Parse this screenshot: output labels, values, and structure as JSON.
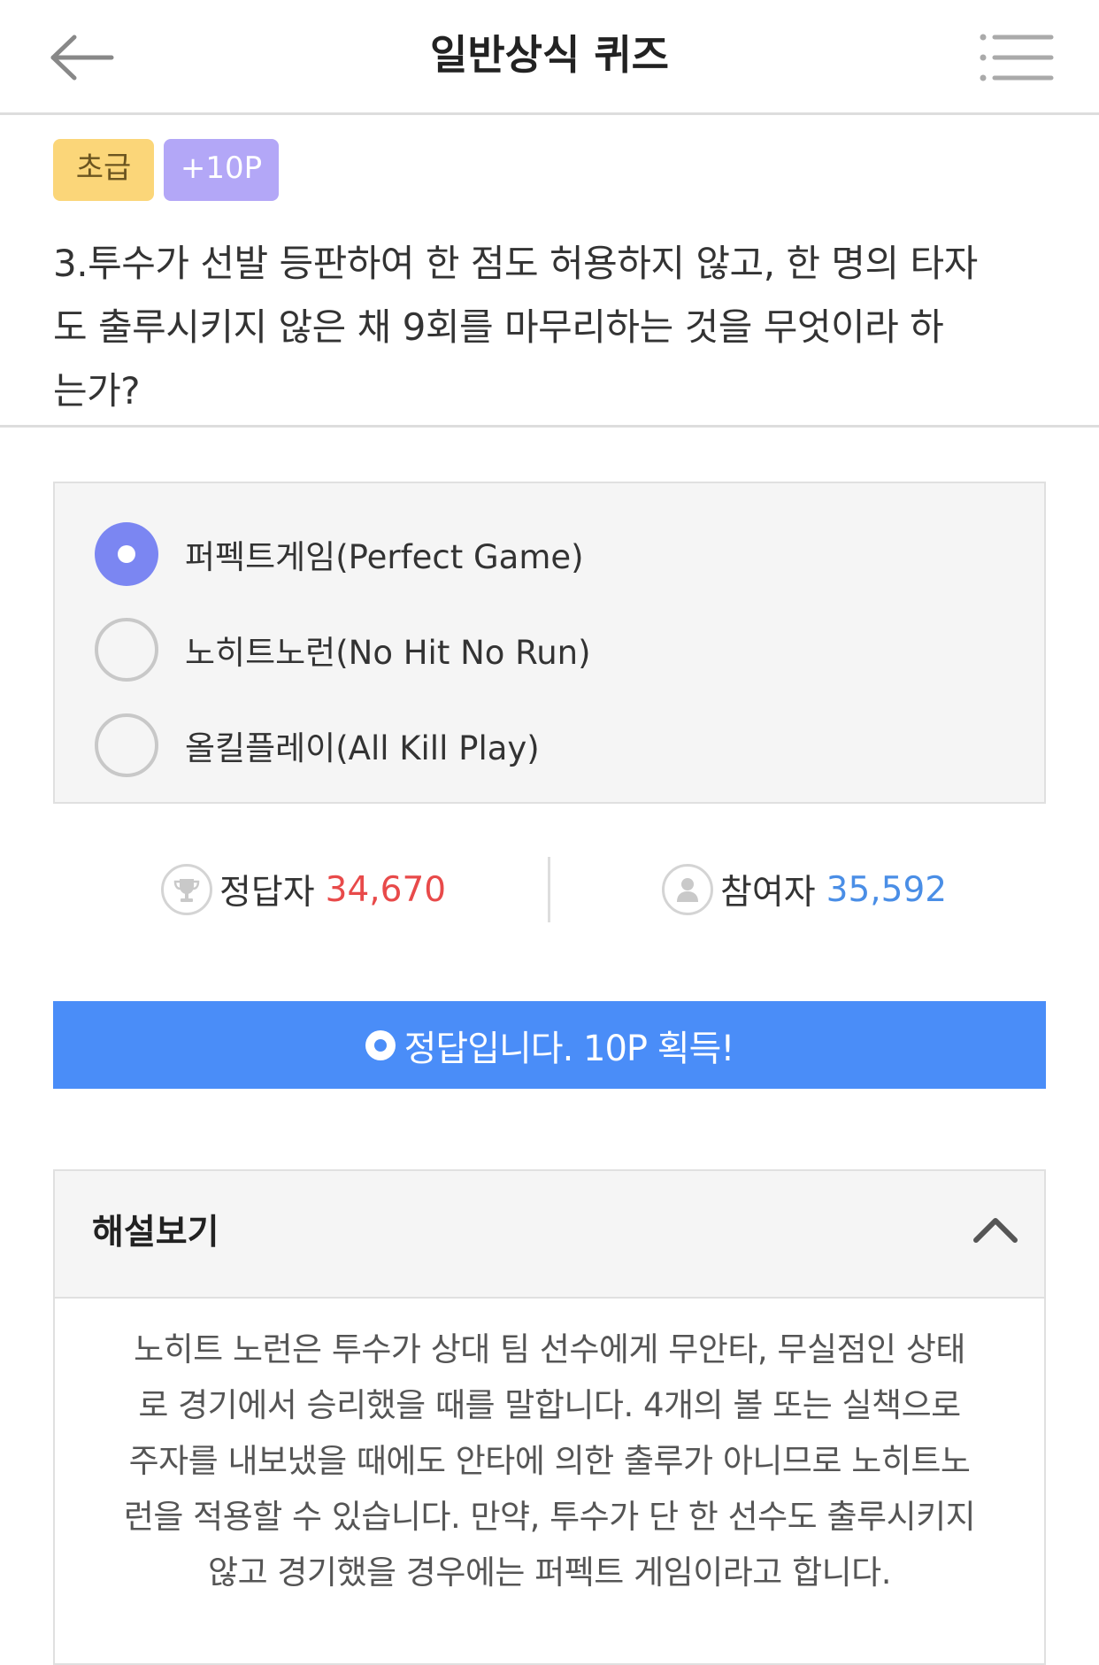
{
  "header": {
    "title": "일반상식 퀴즈",
    "back_icon": "arrow-left-icon",
    "menu_icon": "list-menu-icon"
  },
  "badges": {
    "level": "초급",
    "points": "+10P"
  },
  "question": {
    "lines": [
      "3.투수가 선발 등판하여 한 점도 허용하지 않고, 한 명의 타자",
      "도 출루시키지 않은 채 9회를 마무리하는 것을 무엇이라 하",
      "는가?"
    ]
  },
  "options": [
    {
      "label": "퍼펙트게임(Perfect Game)",
      "selected": true
    },
    {
      "label": "노히트노런(No Hit No Run)",
      "selected": false
    },
    {
      "label": "올킬플레이(All Kill Play)",
      "selected": false
    }
  ],
  "stats": {
    "correct_label": "정답자",
    "correct_value": "34,670",
    "participants_label": "참여자",
    "participants_value": "35,592",
    "correct_color": "#e84a4a",
    "participants_color": "#4a8ee6"
  },
  "result": {
    "text": "정답입니다. 10P 획득!",
    "color": "#4a8df8"
  },
  "explanation": {
    "title": "해설보기",
    "lines": [
      "노히트 노런은 투수가 상대 팀 선수에게 무안타, 무실점인 상태",
      "로 경기에서 승리했을 때를 말합니다. 4개의 볼 또는 실책으로",
      "주자를 내보냈을 때에도 안타에 의한 출루가 아니므로 노히트노",
      "런을 적용할 수 있습니다. 만약, 투수가 단 한 선수도 출루시키지",
      "않고 경기했을 경우에는 퍼펙트 게임이라고 합니다."
    ]
  }
}
